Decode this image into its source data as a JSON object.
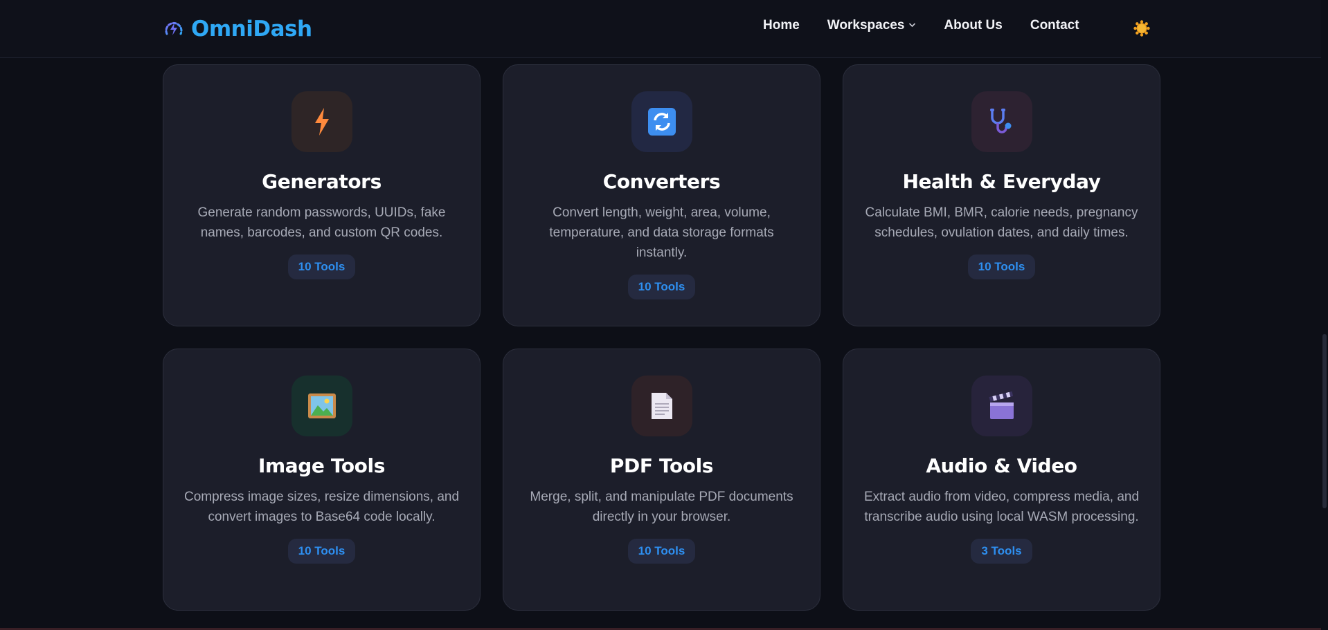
{
  "brand": {
    "name": "OmniDash",
    "logo_icon": "lightning-gauge-icon"
  },
  "nav": {
    "items": [
      {
        "label": "Home"
      },
      {
        "label": "Workspaces"
      },
      {
        "label": "About Us"
      },
      {
        "label": "Contact"
      }
    ],
    "theme_icon": "sun-icon"
  },
  "categories": [
    {
      "title": "Generators",
      "description": "Generate random passwords, UUIDs, fake names, barcodes, and custom QR codes.",
      "badge": "10 Tools",
      "icon": "lightning-icon"
    },
    {
      "title": "Converters",
      "description": "Convert length, weight, area, volume, temperature, and data storage formats instantly.",
      "badge": "10 Tools",
      "icon": "refresh-icon"
    },
    {
      "title": "Health & Everyday",
      "description": "Calculate BMI, BMR, calorie needs, pregnancy schedules, ovulation dates, and daily times.",
      "badge": "10 Tools",
      "icon": "stethoscope-icon"
    },
    {
      "title": "Image Tools",
      "description": "Compress image sizes, resize dimensions, and convert images to Base64 code locally.",
      "badge": "10 Tools",
      "icon": "framed-picture-icon"
    },
    {
      "title": "PDF Tools",
      "description": "Merge, split, and manipulate PDF documents directly in your browser.",
      "badge": "10 Tools",
      "icon": "document-icon"
    },
    {
      "title": "Audio & Video",
      "description": "Extract audio from video, compress media, and transcribe audio using local WASM processing.",
      "badge": "3 Tools",
      "icon": "clapperboard-icon"
    }
  ],
  "colors": {
    "accent": "#2fa8f5",
    "badge_text": "#2e8ff0",
    "card_bg": "#1c1e2a",
    "page_bg": "#0d0f17"
  }
}
